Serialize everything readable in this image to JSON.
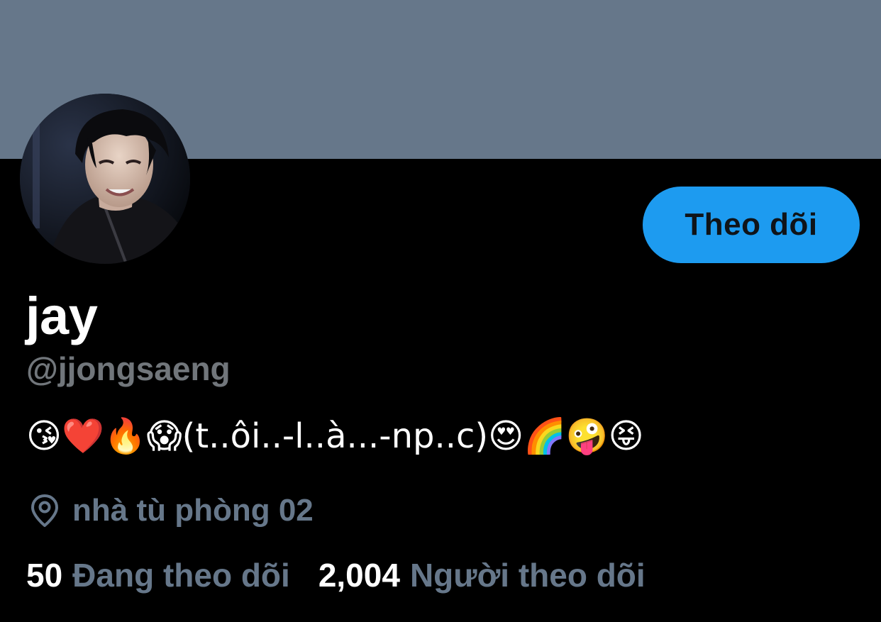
{
  "profile": {
    "display_name": "jay",
    "handle": "@jjongsaeng",
    "bio": "😘❤️🔥😱(t..ôi..-l..à...-np..c)😍🌈🤪😝",
    "location": "nhà tù phòng 02",
    "location_icon": "map-pin-icon",
    "follow_label": "Theo dõi"
  },
  "stats": {
    "following_count": "50",
    "following_label": "Đang theo dõi",
    "followers_count": "2,004",
    "followers_label": "Người theo dõi"
  },
  "colors": {
    "banner": "#66778a",
    "background": "#000000",
    "accent": "#1d9bf0",
    "muted_text": "#66778a"
  }
}
